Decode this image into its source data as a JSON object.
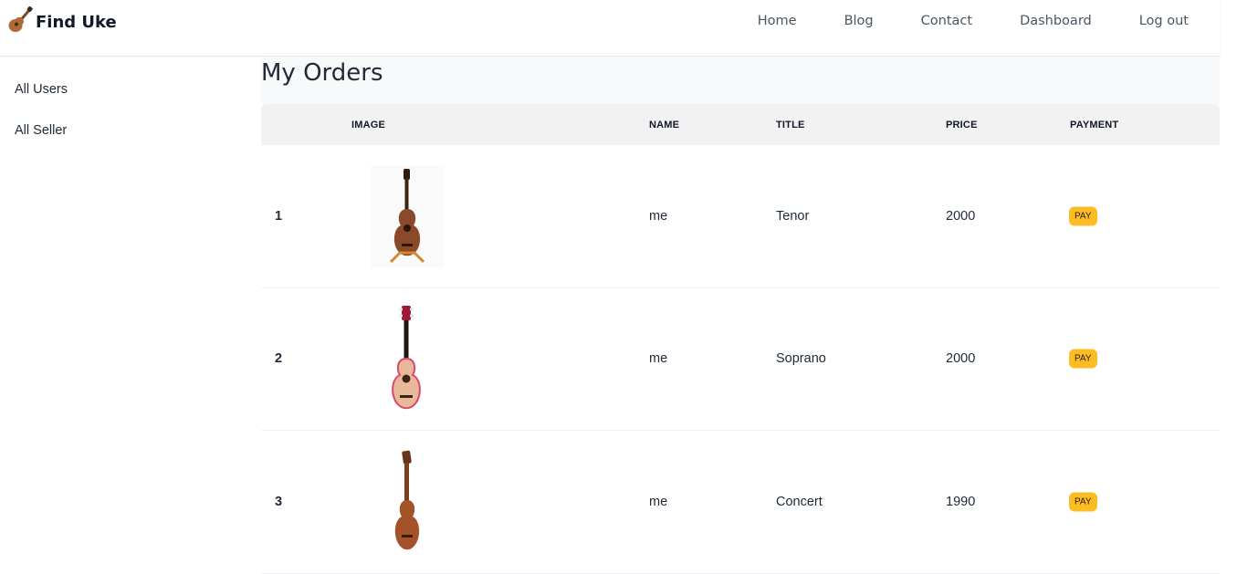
{
  "brand": {
    "name": "Find Uke",
    "logo_icon": "ukulele-icon"
  },
  "nav": {
    "links": [
      "Home",
      "Blog",
      "Contact",
      "Dashboard",
      "Log out"
    ]
  },
  "sidebar": {
    "items": [
      {
        "label": "All Users"
      },
      {
        "label": "All Seller"
      }
    ]
  },
  "page": {
    "title": "My Orders"
  },
  "table": {
    "headers": {
      "image": "IMAGE",
      "name": "NAME",
      "title": "TITLE",
      "price": "PRICE",
      "payment": "PAYMENT"
    },
    "rows": [
      {
        "index": "1",
        "image_icon": "tenor-ukulele-photo",
        "name": "me",
        "title": "Tenor",
        "price": "2000",
        "payment_label": "PAY"
      },
      {
        "index": "2",
        "image_icon": "soprano-ukulele-photo",
        "name": "me",
        "title": "Soprano",
        "price": "2000",
        "payment_label": "PAY"
      },
      {
        "index": "3",
        "image_icon": "concert-ukulele-photo",
        "name": "me",
        "title": "Concert",
        "price": "1990",
        "payment_label": "PAY"
      }
    ]
  },
  "colors": {
    "pay_button": "#fbbd23",
    "main_bg": "#f8f9fb",
    "header_bg": "#f2f2f2"
  }
}
